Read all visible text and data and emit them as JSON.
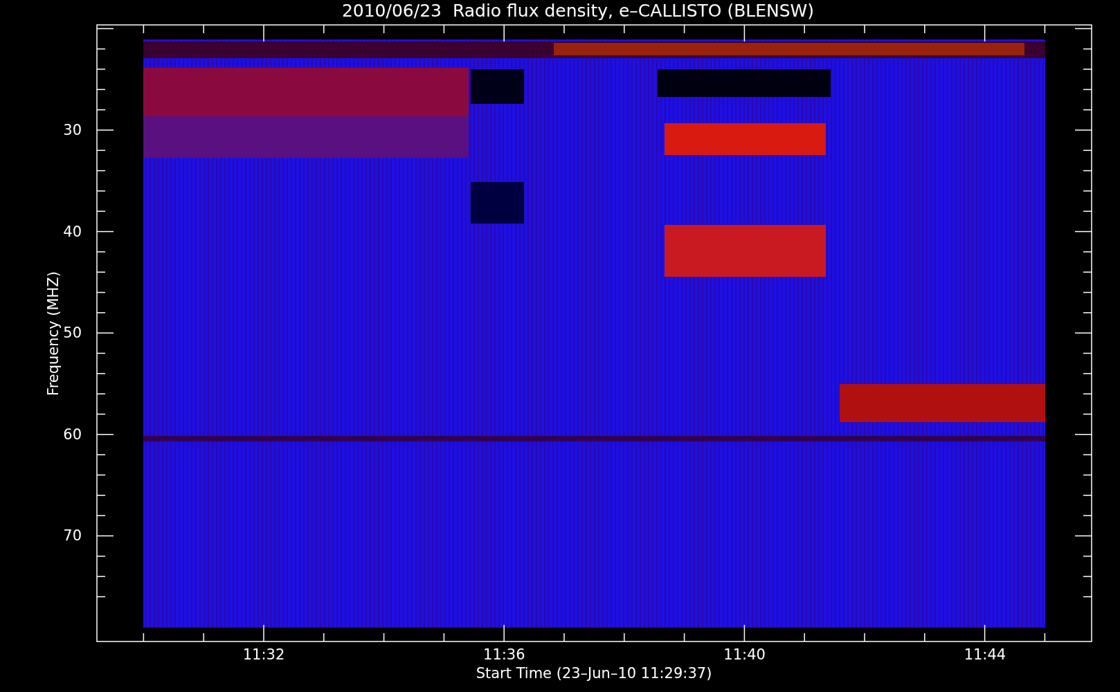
{
  "title": "2010/06/23  Radio flux density, e–CALLISTO (BLENSW)",
  "y_axis": {
    "label": "Frequency (MHZ)",
    "ticks": [
      "30",
      "40",
      "50",
      "60",
      "70"
    ]
  },
  "x_axis": {
    "label": "Start Time (23–Jun–10 11:29:37)",
    "ticks": [
      "11:32",
      "11:36",
      "11:40",
      "11:44"
    ]
  }
}
